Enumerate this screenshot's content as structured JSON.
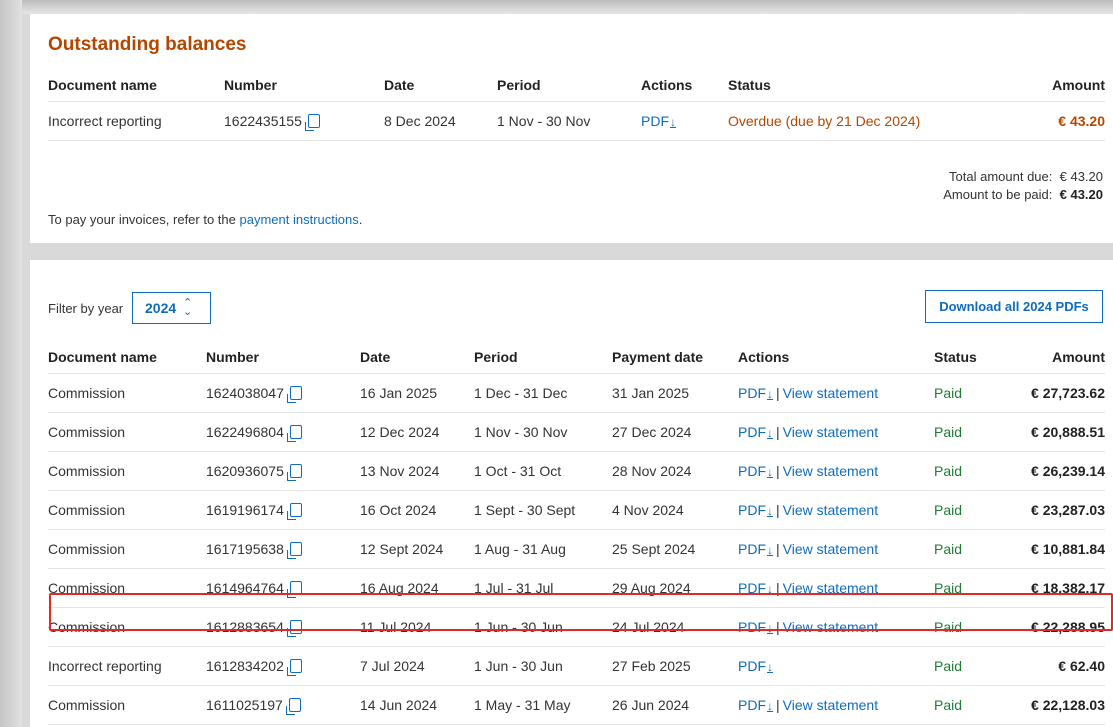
{
  "outstanding": {
    "title": "Outstanding balances",
    "headers": {
      "document_name": "Document name",
      "number": "Number",
      "date": "Date",
      "period": "Period",
      "actions": "Actions",
      "status": "Status",
      "amount": "Amount"
    },
    "rows": [
      {
        "document_name": "Incorrect reporting",
        "number": "1622435155",
        "date": "8 Dec 2024",
        "period": "1 Nov - 30 Nov",
        "pdf": "PDF",
        "status": "Overdue (due by 21 Dec 2024)",
        "amount": "€ 43.20"
      }
    ],
    "total_due_label": "Total amount due:",
    "total_due_value": "€ 43.20",
    "to_be_paid_label": "Amount to be paid:",
    "to_be_paid_value": "€ 43.20",
    "pay_note_prefix": "To pay your invoices, refer to the",
    "pay_note_link": "payment instructions",
    "pay_note_suffix": "."
  },
  "history": {
    "filter_label": "Filter by year",
    "year": "2024",
    "download_all": "Download all 2024 PDFs",
    "headers": {
      "document_name": "Document name",
      "number": "Number",
      "date": "Date",
      "period": "Period",
      "payment_date": "Payment date",
      "actions": "Actions",
      "status": "Status",
      "amount": "Amount"
    },
    "rows": [
      {
        "document_name": "Commission",
        "number": "1624038047",
        "date": "16 Jan 2025",
        "period": "1 Dec - 31 Dec",
        "payment_date": "31 Jan 2025",
        "pdf": "PDF",
        "view": "View statement",
        "status": "Paid",
        "amount": "€ 27,723.62"
      },
      {
        "document_name": "Commission",
        "number": "1622496804",
        "date": "12 Dec 2024",
        "period": "1 Nov - 30 Nov",
        "payment_date": "27 Dec 2024",
        "pdf": "PDF",
        "view": "View statement",
        "status": "Paid",
        "amount": "€ 20,888.51"
      },
      {
        "document_name": "Commission",
        "number": "1620936075",
        "date": "13 Nov 2024",
        "period": "1 Oct - 31 Oct",
        "payment_date": "28 Nov 2024",
        "pdf": "PDF",
        "view": "View statement",
        "status": "Paid",
        "amount": "€ 26,239.14"
      },
      {
        "document_name": "Commission",
        "number": "1619196174",
        "date": "16 Oct 2024",
        "period": "1 Sept - 30 Sept",
        "payment_date": "4 Nov 2024",
        "pdf": "PDF",
        "view": "View statement",
        "status": "Paid",
        "amount": "€ 23,287.03"
      },
      {
        "document_name": "Commission",
        "number": "1617195638",
        "date": "12 Sept 2024",
        "period": "1 Aug - 31 Aug",
        "payment_date": "25 Sept 2024",
        "pdf": "PDF",
        "view": "View statement",
        "status": "Paid",
        "amount": "€ 10,881.84"
      },
      {
        "document_name": "Commission",
        "number": "1614964764",
        "date": "16 Aug 2024",
        "period": "1 Jul - 31 Jul",
        "payment_date": "29 Aug 2024",
        "pdf": "PDF",
        "view": "View statement",
        "status": "Paid",
        "amount": "€ 18,382.17"
      },
      {
        "document_name": "Commission",
        "number": "1612883654",
        "date": "11 Jul 2024",
        "period": "1 Jun - 30 Jun",
        "payment_date": "24 Jul 2024",
        "pdf": "PDF",
        "view": "View statement",
        "status": "Paid",
        "amount": "€ 22,288.95"
      },
      {
        "document_name": "Incorrect reporting",
        "number": "1612834202",
        "date": "7 Jul 2024",
        "period": "1 Jun - 30 Jun",
        "payment_date": "27 Feb 2025",
        "pdf": "PDF",
        "view": "",
        "status": "Paid",
        "amount": "€ 62.40"
      },
      {
        "document_name": "Commission",
        "number": "1611025197",
        "date": "14 Jun 2024",
        "period": "1 May - 31 May",
        "payment_date": "26 Jun 2024",
        "pdf": "PDF",
        "view": "View statement",
        "status": "Paid",
        "amount": "€ 22,128.03"
      }
    ]
  },
  "colors": {
    "accent": "#0f6cbd",
    "overdue": "#b34700",
    "paid": "#1e7b34",
    "highlight": "#e02a2a"
  },
  "icons": {
    "copy": "copy-icon",
    "download": "download-icon",
    "chevron": "chevron-up-down-icon"
  }
}
